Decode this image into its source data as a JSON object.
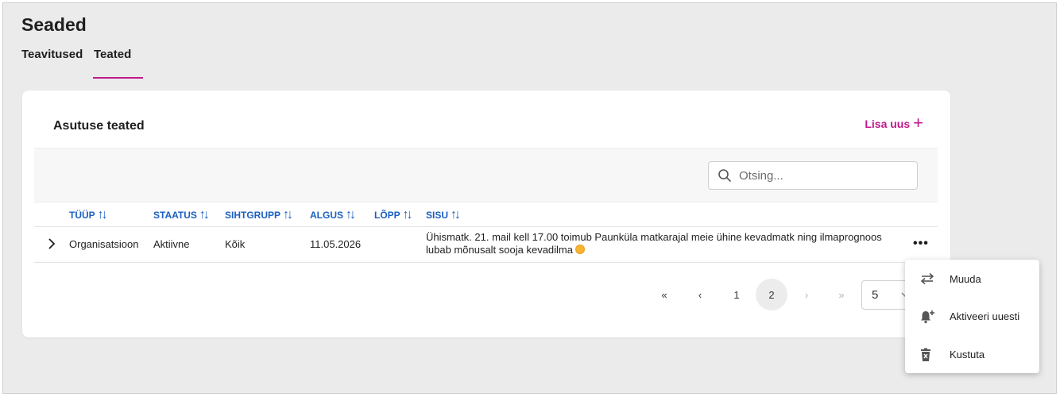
{
  "page": {
    "title": "Seaded"
  },
  "tabs": [
    {
      "label": "Teavitused"
    },
    {
      "label": "Teated",
      "active": true
    }
  ],
  "colors": {
    "accent": "#c2188b",
    "link": "#1b5fc1"
  },
  "card": {
    "title": "Asutuse teated",
    "add_label": "Lisa uus",
    "add_icon": "plus-icon"
  },
  "search": {
    "placeholder": "Otsing...",
    "value": ""
  },
  "table": {
    "columns": [
      "TÜÜP",
      "STAATUS",
      "SIHTGRUPP",
      "ALGUS",
      "LÕPP",
      "SISU"
    ],
    "rows": [
      {
        "type": "Organisatsioon",
        "status": "Aktiivne",
        "target": "Kõik",
        "start": "11.05.2026",
        "end": "",
        "content": "Ühismatk. 21. mail kell 17.00 toimub Paunküla matkarajal meie ühine kevadmatk ning ilmaprognoos lubab mõnusalt sooja kevadilma",
        "content_icon": "sun-emoji"
      }
    ]
  },
  "pagination": {
    "pages": [
      "1",
      "2"
    ],
    "current": "2",
    "page_size": "5"
  },
  "context_menu": {
    "items": [
      {
        "label": "Muuda",
        "icon": "swap-arrows-icon"
      },
      {
        "label": "Aktiveeri uuesti",
        "icon": "bell-plus-icon"
      },
      {
        "label": "Kustuta",
        "icon": "trash-icon"
      }
    ]
  }
}
